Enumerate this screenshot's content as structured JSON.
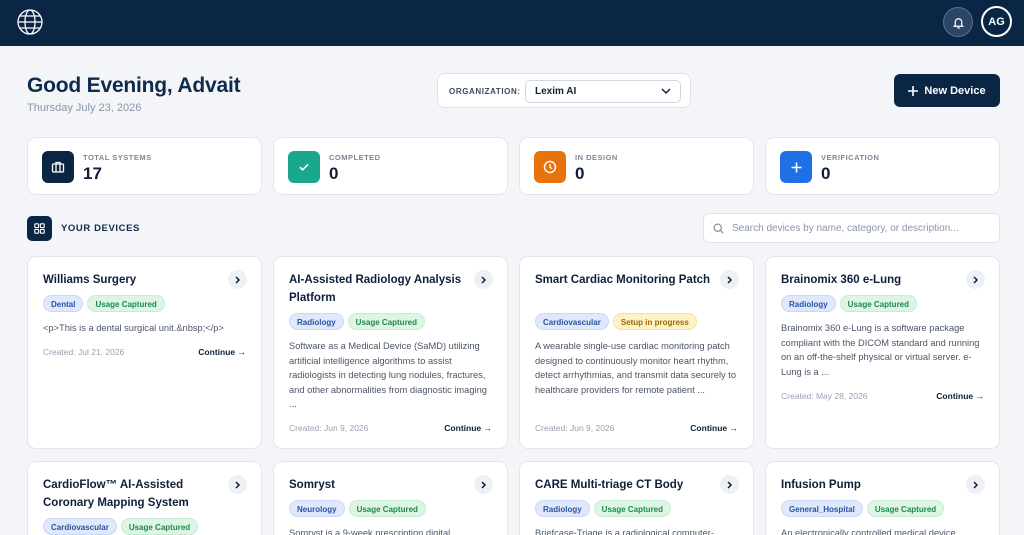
{
  "header": {
    "greeting": "Good Evening, Advait",
    "date": "Thursday July 23, 2026",
    "avatar_initials": "AG"
  },
  "organization": {
    "label": "ORGANIZATION:",
    "selected": "Lexim AI"
  },
  "new_device_label": "New Device",
  "stats": [
    {
      "label": "TOTAL SYSTEMS",
      "value": "17",
      "color": "#0b2545",
      "icon": "briefcase-icon"
    },
    {
      "label": "COMPLETED",
      "value": "0",
      "color": "#1aa88a",
      "icon": "check-icon"
    },
    {
      "label": "IN DESIGN",
      "value": "0",
      "color": "#e8720c",
      "icon": "clock-icon"
    },
    {
      "label": "VERIFICATION",
      "value": "0",
      "color": "#1f6fe5",
      "icon": "plus-icon"
    }
  ],
  "devices_section": {
    "title": "YOUR DEVICES",
    "search_placeholder": "Search devices by name, category, or description..."
  },
  "continue_label": "Continue →",
  "devices": [
    {
      "title": "Williams Surgery",
      "tags": [
        {
          "text": "Dental",
          "style": "blue"
        },
        {
          "text": "Usage Captured",
          "style": "green"
        }
      ],
      "description": "<p>This is a dental surgical unit.&nbsp;</p>",
      "created": "Created: Jul 21, 2026"
    },
    {
      "title": "AI-Assisted Radiology Analysis Platform",
      "tags": [
        {
          "text": "Radiology",
          "style": "blue"
        },
        {
          "text": "Usage Captured",
          "style": "green"
        }
      ],
      "description": "Software as a Medical Device (SaMD) utilizing artificial intelligence algorithms to assist radiologists in detecting lung nodules, fractures, and other abnormalities from diagnostic imaging ...",
      "created": "Created: Jun 9, 2026"
    },
    {
      "title": "Smart Cardiac Monitoring Patch",
      "tags": [
        {
          "text": "Cardiovascular",
          "style": "blue"
        },
        {
          "text": "Setup in progress",
          "style": "yellow"
        }
      ],
      "description": "A wearable single-use cardiac monitoring patch designed to continuously monitor heart rhythm, detect arrhythmias, and transmit data securely to healthcare providers for remote patient ...",
      "created": "Created: Jun 9, 2026"
    },
    {
      "title": "Brainomix 360 e-Lung",
      "tags": [
        {
          "text": "Radiology",
          "style": "blue"
        },
        {
          "text": "Usage Captured",
          "style": "green"
        }
      ],
      "description": "Brainomix 360 e-Lung is a software package compliant with the DICOM standard and running on an off-the-shelf physical or virtual server. e-Lung is a ...",
      "created": "Created: May 28, 2026"
    },
    {
      "title": "CardioFlow™ AI-Assisted Coronary Mapping System",
      "tags": [
        {
          "text": "Cardiovascular",
          "style": "blue"
        },
        {
          "text": "Usage Captured",
          "style": "green"
        }
      ],
      "description": "",
      "created": ""
    },
    {
      "title": "Somryst",
      "tags": [
        {
          "text": "Neurology",
          "style": "blue"
        },
        {
          "text": "Usage Captured",
          "style": "green"
        }
      ],
      "description": "Somryst is a 9-week prescription digital",
      "created": ""
    },
    {
      "title": "CARE Multi-triage CT Body",
      "tags": [
        {
          "text": "Radiology",
          "style": "blue"
        },
        {
          "text": "Usage Captured",
          "style": "green"
        }
      ],
      "description": "Briefcase-Triage is a radiological computer-",
      "created": ""
    },
    {
      "title": "Infusion Pump",
      "tags": [
        {
          "text": "General_Hospital",
          "style": "blue"
        },
        {
          "text": "Usage Captured",
          "style": "green"
        }
      ],
      "description": "An electronically controlled medical device",
      "created": ""
    }
  ]
}
